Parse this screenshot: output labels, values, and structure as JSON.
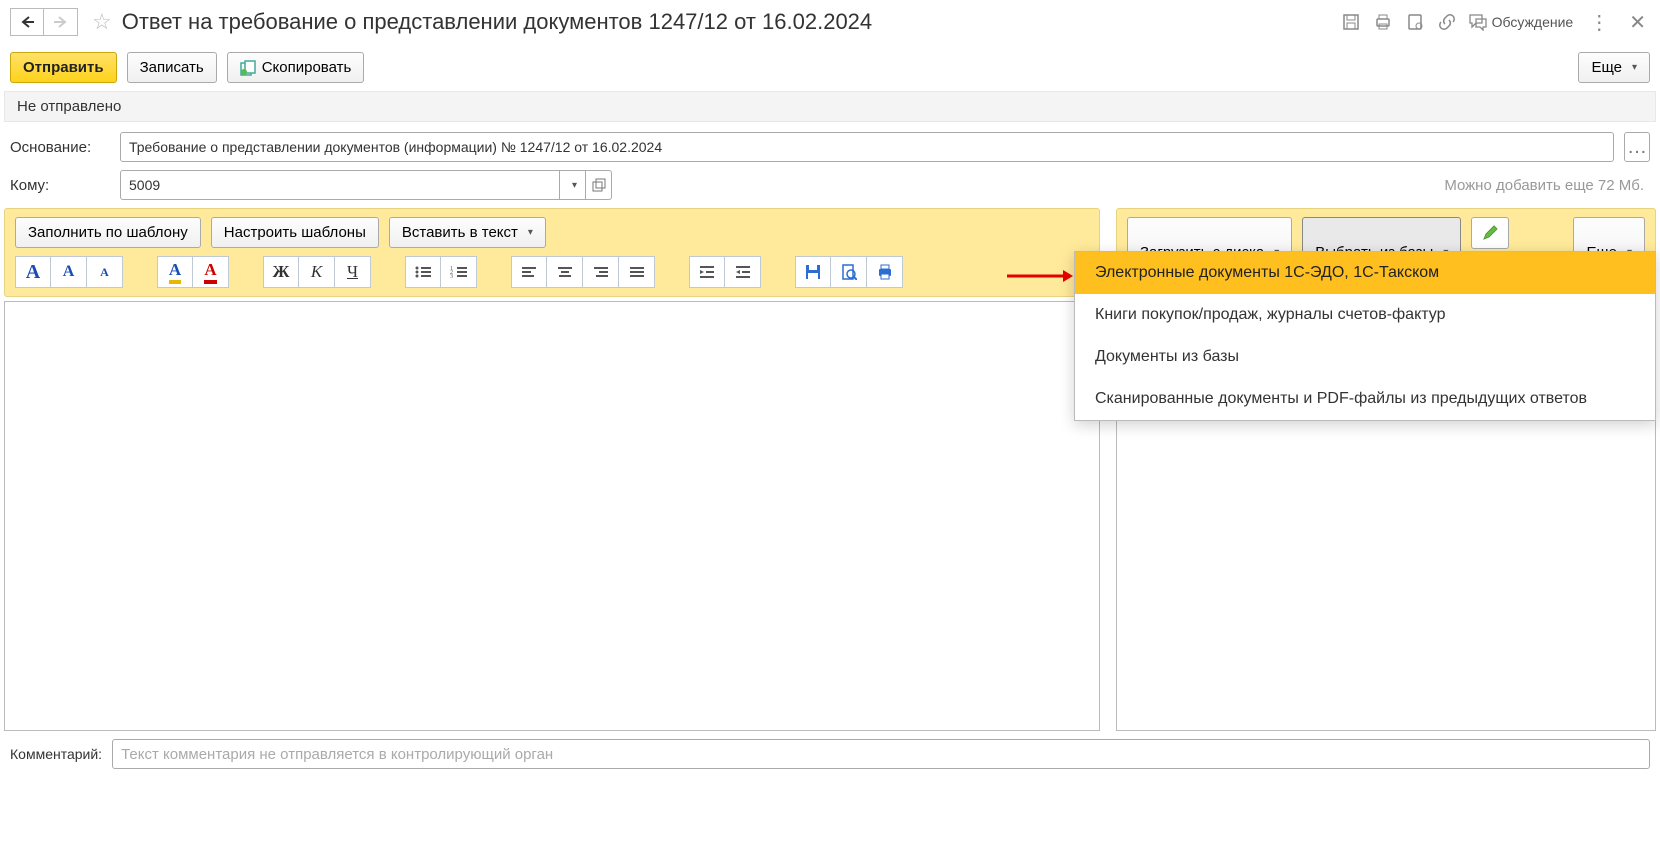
{
  "title": "Ответ на требование о представлении документов 1247/12 от 16.02.2024",
  "discussion_label": "Обсуждение",
  "cmdbar": {
    "send": "Отправить",
    "save": "Записать",
    "copy": "Скопировать",
    "more": "Еще"
  },
  "status": "Не отправлено",
  "form": {
    "basis_label": "Основание:",
    "basis_value": "Требование о представлении документов (информации) № 1247/12 от 16.02.2024",
    "to_label": "Кому:",
    "to_value": "5009",
    "attach_hint": "Можно добавить еще 72 Мб."
  },
  "left_toolbar": {
    "fill_template": "Заполнить по шаблону",
    "configure_templates": "Настроить шаблоны",
    "insert_text": "Вставить в текст"
  },
  "right_toolbar": {
    "load_disk": "Загрузить с диска",
    "select_base": "Выбрать из базы",
    "more": "Еще"
  },
  "dropdown": {
    "items": [
      "Электронные документы 1С-ЭДО, 1С-Такском",
      "Книги покупок/продаж, журналы счетов-фактур",
      "Документы из базы",
      "Сканированные документы и PDF-файлы из предыдущих ответов"
    ]
  },
  "comment": {
    "label": "Комментарий:",
    "placeholder": "Текст комментария не отправляется в контролирующий орган"
  }
}
